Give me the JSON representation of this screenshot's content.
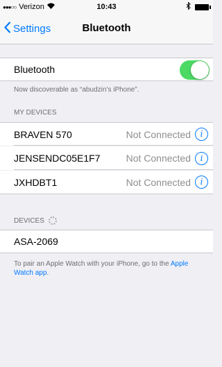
{
  "status_bar": {
    "carrier": "Verizon",
    "time": "10:43"
  },
  "nav": {
    "back_label": "Settings",
    "title": "Bluetooth"
  },
  "bluetooth_toggle": {
    "label": "Bluetooth",
    "on": true
  },
  "discoverable_text": "Now discoverable as “abudzin’s iPhone”.",
  "my_devices": {
    "header": "MY DEVICES",
    "items": [
      {
        "name": "BRAVEN 570",
        "status": "Not Connected"
      },
      {
        "name": "JENSENDC05E1F7",
        "status": "Not Connected"
      },
      {
        "name": "JXHDBT1",
        "status": "Not Connected"
      }
    ]
  },
  "devices": {
    "header": "DEVICES",
    "items": [
      {
        "name": "ASA-2069"
      }
    ]
  },
  "footer": {
    "text": "To pair an Apple Watch with your iPhone, go to the ",
    "link": "Apple Watch app",
    "end": "."
  },
  "colors": {
    "accent": "#007aff",
    "toggle_on": "#4cd964",
    "background": "#efeff4"
  },
  "icons": [
    "wifi-icon",
    "bluetooth-icon",
    "battery-icon",
    "chevron-left-icon",
    "info-icon",
    "spinner-icon"
  ]
}
